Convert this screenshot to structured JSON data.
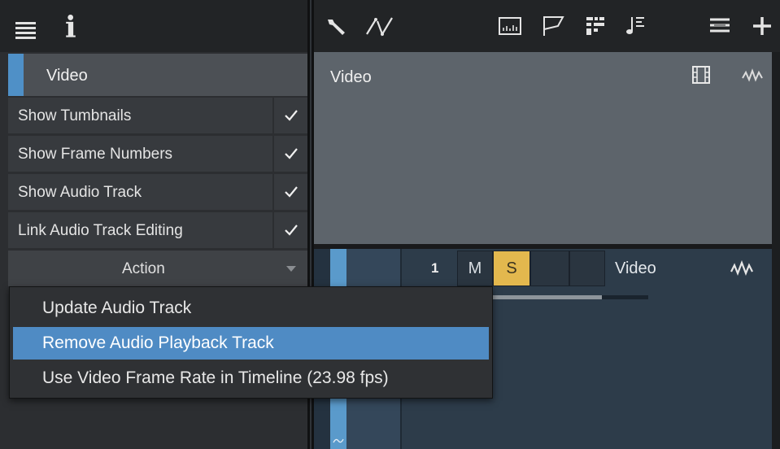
{
  "inspector": {
    "section_title": "Video",
    "options": [
      {
        "label": "Show Tumbnails",
        "checked": true
      },
      {
        "label": "Show Frame Numbers",
        "checked": true
      },
      {
        "label": "Show Audio Track",
        "checked": true
      },
      {
        "label": "Link Audio Track Editing",
        "checked": true
      }
    ],
    "action_label": "Action"
  },
  "action_menu": {
    "items": [
      {
        "label": "Update Audio Track"
      },
      {
        "label": "Remove Audio Playback Track",
        "selected": true
      },
      {
        "label": "Use Video Frame Rate in Timeline (23.98 fps)"
      }
    ]
  },
  "video_header": {
    "title": "Video"
  },
  "track": {
    "number": "1",
    "mute_label": "M",
    "solo_label": "S",
    "name": "Video",
    "solo_color": "#e3b84e"
  },
  "colors": {
    "accent": "#4f90c7",
    "menu_selected": "#4f8bc4"
  },
  "icons": [
    "menu-icon",
    "info-icon",
    "wrench-icon",
    "automation-icon",
    "meter-icon",
    "flag-icon",
    "grid-icon",
    "score-icon",
    "list-icon",
    "plus-icon",
    "filmstrip-icon",
    "waveform-icon",
    "checkmark-icon",
    "dropdown-caret-icon"
  ]
}
